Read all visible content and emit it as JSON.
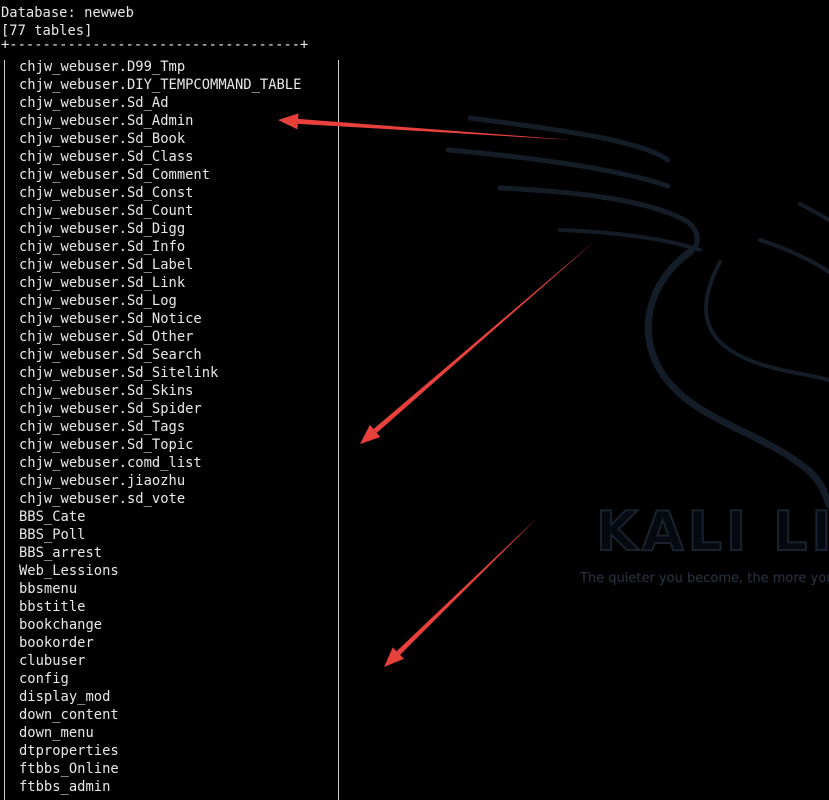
{
  "terminal": {
    "database_label": "Database: newweb",
    "table_count": "[77 tables]",
    "border": "+-----------------------------------+",
    "tables": [
      "chjw_webuser.D99_Tmp",
      "chjw_webuser.DIY_TEMPCOMMAND_TABLE",
      "chjw_webuser.Sd_Ad",
      "chjw_webuser.Sd_Admin",
      "chjw_webuser.Sd_Book",
      "chjw_webuser.Sd_Class",
      "chjw_webuser.Sd_Comment",
      "chjw_webuser.Sd_Const",
      "chjw_webuser.Sd_Count",
      "chjw_webuser.Sd_Digg",
      "chjw_webuser.Sd_Info",
      "chjw_webuser.Sd_Label",
      "chjw_webuser.Sd_Link",
      "chjw_webuser.Sd_Log",
      "chjw_webuser.Sd_Notice",
      "chjw_webuser.Sd_Other",
      "chjw_webuser.Sd_Search",
      "chjw_webuser.Sd_Sitelink",
      "chjw_webuser.Sd_Skins",
      "chjw_webuser.Sd_Spider",
      "chjw_webuser.Sd_Tags",
      "chjw_webuser.Sd_Topic",
      "chjw_webuser.comd_list",
      "chjw_webuser.jiaozhu",
      "chjw_webuser.sd_vote",
      "BBS_Cate",
      "BBS_Poll",
      "BBS_arrest",
      "Web_Lessions",
      "bbsmenu",
      "bbstitle",
      "bookchange",
      "bookorder",
      "clubuser",
      "config",
      "display_mod",
      "down_content",
      "down_menu",
      "dtproperties",
      "ftbbs_Online",
      "ftbbs_admin"
    ]
  },
  "wallpaper": {
    "logo_text": "KALI LIN",
    "slogan": "The quieter you become, the more you"
  },
  "annotations": {
    "arrow_color": "#e8413b",
    "arrows": [
      "pointing-to-sd-admin",
      "pointing-to-table-list",
      "pointing-to-table-list-lower"
    ]
  }
}
